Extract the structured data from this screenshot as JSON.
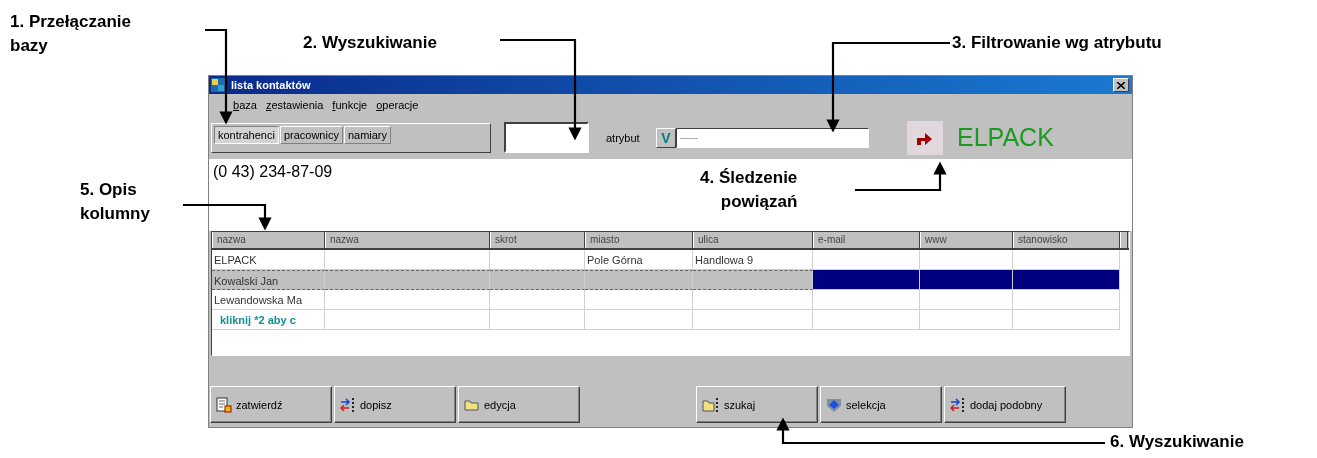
{
  "annotations": [
    {
      "lines": [
        "1. Przełączanie",
        "bazy"
      ]
    },
    {
      "lines": [
        "2. Wyszukiwanie"
      ]
    },
    {
      "lines": [
        "3. Filtrowanie wg atrybutu"
      ]
    },
    {
      "lines": [
        "4. Śledzenie",
        "powiązań"
      ]
    },
    {
      "lines": [
        "5. Opis",
        "kolumny"
      ]
    },
    {
      "lines": [
        "6. Wyszukiwanie"
      ]
    }
  ],
  "window": {
    "title": "lista kontaktów"
  },
  "menu": [
    "baza",
    "zestawienia",
    "funkcje",
    "operacje"
  ],
  "tabs": [
    {
      "label": "kontrahenci",
      "selected": true
    },
    {
      "label": "pracownicy",
      "selected": false
    },
    {
      "label": "namiary",
      "selected": false
    }
  ],
  "filter": {
    "label": "atrybut",
    "toggle": "V",
    "value": "------"
  },
  "current_name": "ELPACK",
  "info": "(0 43) 234-87-09",
  "table": {
    "columns": [
      "nazwa",
      "nazwa",
      "skrot",
      "miasto",
      "ulica",
      "e-mail",
      "www",
      "stanowisko"
    ],
    "rows": [
      {
        "kind": "data",
        "selected": false,
        "cells": [
          "ELPACK",
          null,
          null,
          "Pole Górna",
          "Handlowa 9"
        ]
      },
      {
        "kind": "data",
        "selected": true,
        "cells": [
          "Kowalski Jan"
        ]
      },
      {
        "kind": "data",
        "selected": false,
        "cells": [
          "Lewandowska Ma"
        ]
      },
      {
        "kind": "hint",
        "selected": false,
        "cells": [
          "kliknij *2 aby c"
        ]
      }
    ]
  },
  "button_groups": [
    [
      {
        "label": "zatwierdź",
        "kind": "document"
      },
      {
        "label": "dopisz",
        "kind": "add"
      },
      {
        "label": "edycja",
        "kind": "folder"
      }
    ],
    [
      {
        "label": "szukaj",
        "kind": "find"
      },
      {
        "label": "selekcja",
        "kind": "shield"
      },
      {
        "label": "dodaj podobny",
        "kind": "add"
      }
    ]
  ]
}
